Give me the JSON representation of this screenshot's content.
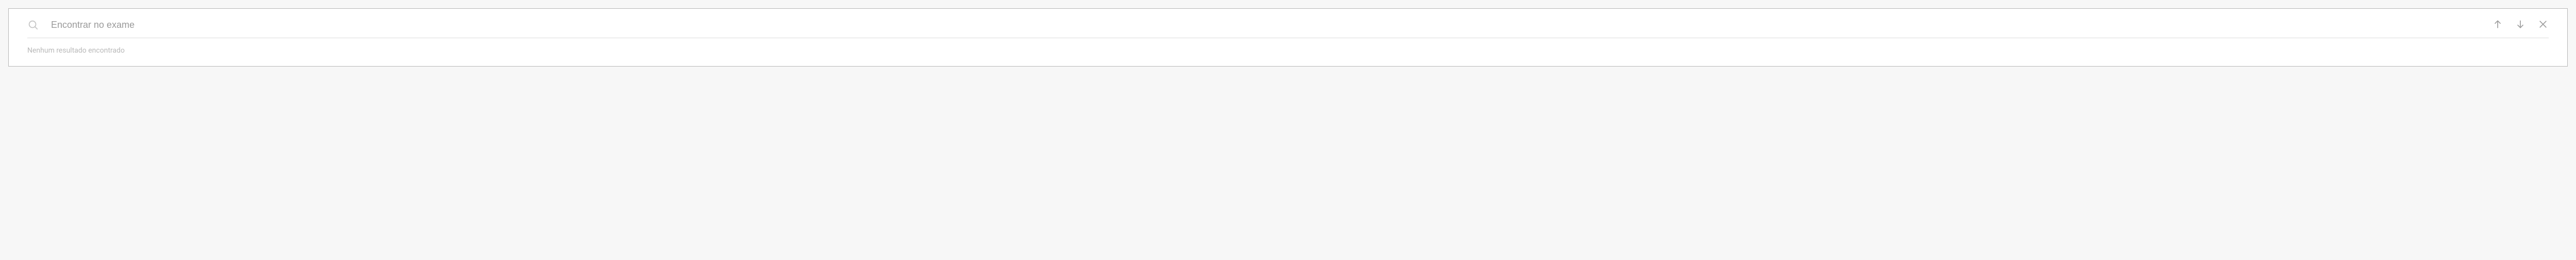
{
  "search": {
    "placeholder": "Encontrar no exame",
    "value": ""
  },
  "status": {
    "message": "Nenhum resultado encontrado"
  }
}
